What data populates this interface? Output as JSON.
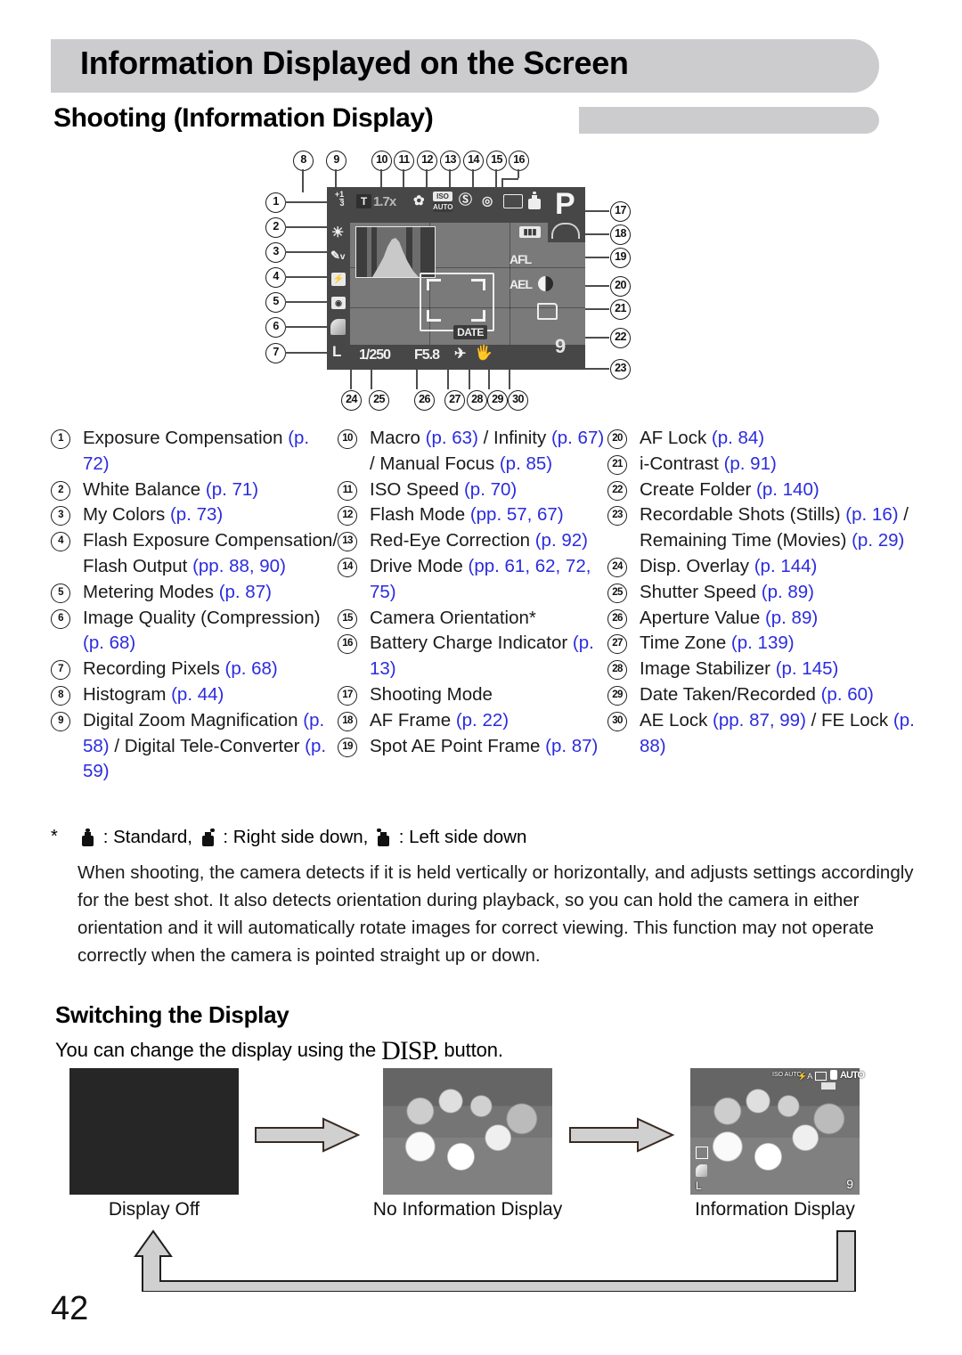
{
  "header": {
    "title": "Information Displayed on the Screen",
    "section": "Shooting (Information Display)"
  },
  "diagram": {
    "lcd_values": {
      "exposure_compensation": "+1/3",
      "digital_zoom": "1.7x",
      "tele_badge": "T",
      "iso": "ISO AUTO",
      "shutter_speed": "1/250",
      "aperture": "F5.8",
      "date_stamp": "DATE",
      "recordable_shots": "9",
      "shooting_mode": "P",
      "af_lock": "AFL",
      "ae_lock": "AEL",
      "recording_pixels": "L"
    },
    "callouts_top": [
      "8",
      "9",
      "10",
      "11",
      "12",
      "13",
      "14",
      "15",
      "16"
    ],
    "callouts_left": [
      "1",
      "2",
      "3",
      "4",
      "5",
      "6",
      "7"
    ],
    "callouts_right": [
      "17",
      "18",
      "19",
      "20",
      "21",
      "22",
      "23"
    ],
    "callouts_bottom": [
      "24",
      "25",
      "26",
      "27",
      "28",
      "29",
      "30"
    ]
  },
  "legend": {
    "column1": [
      {
        "n": "1",
        "parts": [
          {
            "t": "Exposure Compensation ",
            "ref": false
          },
          {
            "t": "(p. 72)",
            "ref": true
          }
        ]
      },
      {
        "n": "2",
        "parts": [
          {
            "t": "White Balance ",
            "ref": false
          },
          {
            "t": "(p. 71)",
            "ref": true
          }
        ]
      },
      {
        "n": "3",
        "parts": [
          {
            "t": "My Colors ",
            "ref": false
          },
          {
            "t": "(p. 73)",
            "ref": true
          }
        ]
      },
      {
        "n": "4",
        "parts": [
          {
            "t": "Flash Exposure Compensation/ Flash Output ",
            "ref": false
          },
          {
            "t": "(pp. 88, 90)",
            "ref": true
          }
        ]
      },
      {
        "n": "5",
        "parts": [
          {
            "t": "Metering Modes ",
            "ref": false
          },
          {
            "t": "(p. 87)",
            "ref": true
          }
        ]
      },
      {
        "n": "6",
        "parts": [
          {
            "t": "Image Quality (Compression) ",
            "ref": false
          },
          {
            "t": "(p. 68)",
            "ref": true
          }
        ]
      },
      {
        "n": "7",
        "parts": [
          {
            "t": "Recording Pixels ",
            "ref": false
          },
          {
            "t": "(p. 68)",
            "ref": true
          }
        ]
      },
      {
        "n": "8",
        "parts": [
          {
            "t": "Histogram ",
            "ref": false
          },
          {
            "t": "(p. 44)",
            "ref": true
          }
        ]
      },
      {
        "n": "9",
        "parts": [
          {
            "t": "Digital Zoom Magnification ",
            "ref": false
          },
          {
            "t": "(p. 58)",
            "ref": true
          },
          {
            "t": " / Digital Tele-Converter ",
            "ref": false
          },
          {
            "t": "(p. 59)",
            "ref": true
          }
        ]
      }
    ],
    "column2": [
      {
        "n": "10",
        "parts": [
          {
            "t": "Macro ",
            "ref": false
          },
          {
            "t": "(p. 63)",
            "ref": true
          },
          {
            "t": " / Infinity ",
            "ref": false
          },
          {
            "t": "(p. 67)",
            "ref": true
          },
          {
            "t": " / Manual Focus ",
            "ref": false
          },
          {
            "t": "(p. 85)",
            "ref": true
          }
        ]
      },
      {
        "n": "11",
        "parts": [
          {
            "t": "ISO Speed ",
            "ref": false
          },
          {
            "t": "(p. 70)",
            "ref": true
          }
        ]
      },
      {
        "n": "12",
        "parts": [
          {
            "t": "Flash Mode ",
            "ref": false
          },
          {
            "t": "(pp. 57, 67)",
            "ref": true
          }
        ]
      },
      {
        "n": "13",
        "parts": [
          {
            "t": "Red-Eye Correction ",
            "ref": false
          },
          {
            "t": "(p. 92)",
            "ref": true
          }
        ]
      },
      {
        "n": "14",
        "parts": [
          {
            "t": "Drive Mode ",
            "ref": false
          },
          {
            "t": "(pp. 61, 62, 72, 75)",
            "ref": true
          }
        ]
      },
      {
        "n": "15",
        "parts": [
          {
            "t": "Camera Orientation*",
            "ref": false
          }
        ]
      },
      {
        "n": "16",
        "parts": [
          {
            "t": "Battery Charge Indicator ",
            "ref": false
          },
          {
            "t": "(p. 13)",
            "ref": true
          }
        ]
      },
      {
        "n": "17",
        "parts": [
          {
            "t": "Shooting Mode",
            "ref": false
          }
        ]
      },
      {
        "n": "18",
        "parts": [
          {
            "t": "AF Frame ",
            "ref": false
          },
          {
            "t": "(p. 22)",
            "ref": true
          }
        ]
      },
      {
        "n": "19",
        "parts": [
          {
            "t": "Spot AE Point Frame ",
            "ref": false
          },
          {
            "t": "(p. 87)",
            "ref": true
          }
        ]
      }
    ],
    "column3": [
      {
        "n": "20",
        "parts": [
          {
            "t": "AF Lock ",
            "ref": false
          },
          {
            "t": "(p. 84)",
            "ref": true
          }
        ]
      },
      {
        "n": "21",
        "parts": [
          {
            "t": "i-Contrast ",
            "ref": false
          },
          {
            "t": "(p. 91)",
            "ref": true
          }
        ]
      },
      {
        "n": "22",
        "parts": [
          {
            "t": "Create Folder ",
            "ref": false
          },
          {
            "t": "(p. 140)",
            "ref": true
          }
        ]
      },
      {
        "n": "23",
        "parts": [
          {
            "t": "Recordable Shots (Stills) ",
            "ref": false
          },
          {
            "t": "(p. 16)",
            "ref": true
          },
          {
            "t": " / Remaining Time (Movies) ",
            "ref": false
          },
          {
            "t": "(p. 29)",
            "ref": true
          }
        ]
      },
      {
        "n": "24",
        "parts": [
          {
            "t": "Disp. Overlay ",
            "ref": false
          },
          {
            "t": "(p. 144)",
            "ref": true
          }
        ]
      },
      {
        "n": "25",
        "parts": [
          {
            "t": "Shutter Speed ",
            "ref": false
          },
          {
            "t": "(p. 89)",
            "ref": true
          }
        ]
      },
      {
        "n": "26",
        "parts": [
          {
            "t": "Aperture Value ",
            "ref": false
          },
          {
            "t": "(p. 89)",
            "ref": true
          }
        ]
      },
      {
        "n": "27",
        "parts": [
          {
            "t": "Time Zone ",
            "ref": false
          },
          {
            "t": "(p. 139)",
            "ref": true
          }
        ]
      },
      {
        "n": "28",
        "parts": [
          {
            "t": "Image Stabilizer ",
            "ref": false
          },
          {
            "t": "(p. 145)",
            "ref": true
          }
        ]
      },
      {
        "n": "29",
        "parts": [
          {
            "t": "Date Taken/Recorded ",
            "ref": false
          },
          {
            "t": "(p. 60)",
            "ref": true
          }
        ]
      },
      {
        "n": "30",
        "parts": [
          {
            "t": "AE Lock ",
            "ref": false
          },
          {
            "t": "(pp. 87, 99)",
            "ref": true
          },
          {
            "t": " / FE Lock ",
            "ref": false
          },
          {
            "t": "(p. 88)",
            "ref": true
          }
        ]
      }
    ]
  },
  "footnote": {
    "star": "*",
    "legend_standard": ": Standard,",
    "legend_right": ": Right side down,",
    "legend_left": ": Left side down",
    "paragraph": "When shooting, the camera detects if it is held vertically or horizontally, and adjusts settings accordingly for the best shot. It also detects orientation during playback, so you can hold the camera in either orientation and it will automatically rotate images for correct viewing. This function may not operate correctly when the camera is pointed straight up or down."
  },
  "switching": {
    "heading": "Switching the Display",
    "instruction_before": "You can change the display using the ",
    "disp_glyph": "DISP.",
    "instruction_after": " button.",
    "thumbnails": [
      {
        "label": "Display Off",
        "kind": "off"
      },
      {
        "label": "No Information Display",
        "kind": "photo"
      },
      {
        "label": "Information Display",
        "kind": "photo-info"
      }
    ],
    "info_overlay": {
      "iso": "ISO AUTO",
      "mode": "AUTO",
      "shots": "9",
      "pixels": "L"
    }
  },
  "page_number": "42",
  "colors": {
    "banner": "#ccccce",
    "reference_link": "#2b2bdd",
    "lcd_background": "#7a7a7a",
    "lcd_bar": "#474747"
  }
}
